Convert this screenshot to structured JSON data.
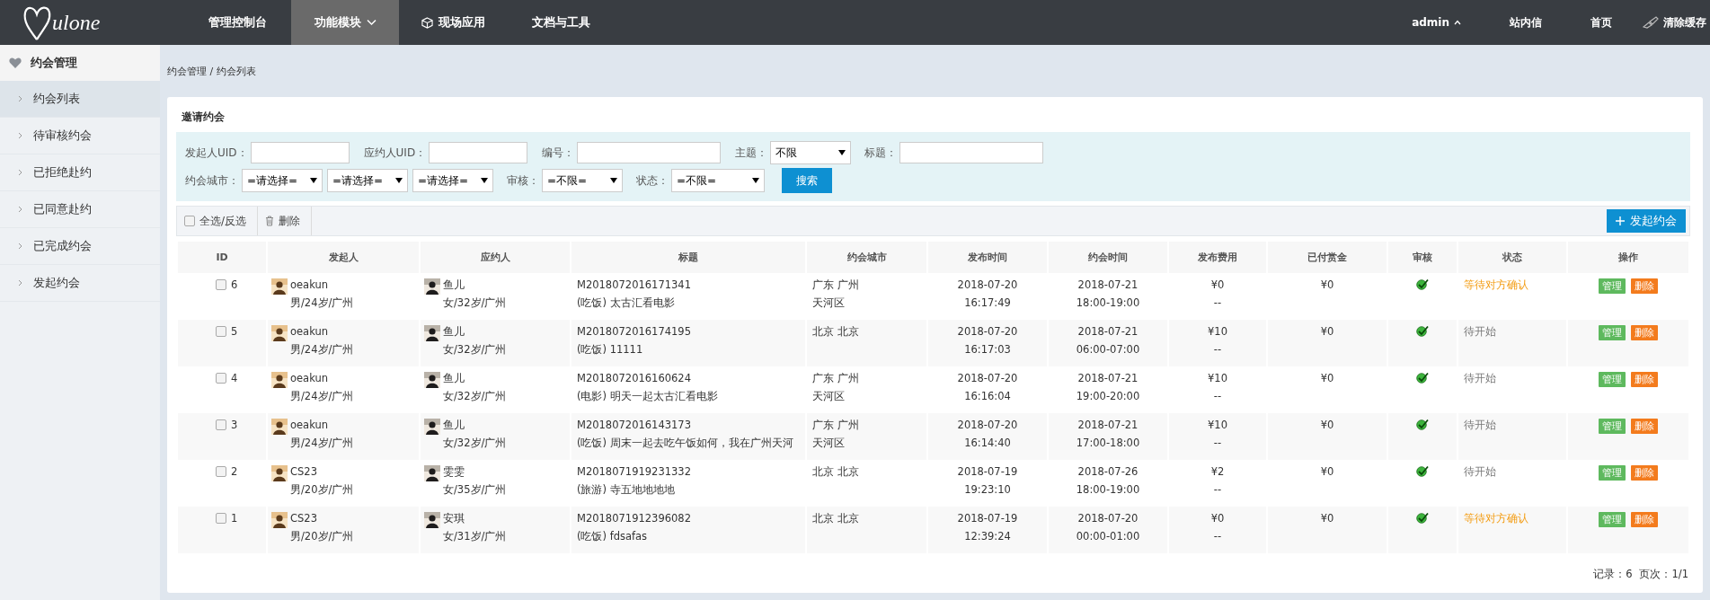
{
  "logo": "ulone",
  "nav": [
    {
      "label": "管理控制台",
      "selected": false,
      "dropdown": false,
      "kind": "text"
    },
    {
      "label": "功能模块",
      "selected": true,
      "dropdown": true,
      "kind": "text"
    },
    {
      "label": "现场应用",
      "selected": false,
      "dropdown": false,
      "kind": "cube"
    },
    {
      "label": "文档与工具",
      "selected": false,
      "dropdown": false,
      "kind": "text"
    }
  ],
  "user_nav": [
    {
      "label": "admin",
      "kind": "user"
    },
    {
      "label": "站内信",
      "kind": "link"
    },
    {
      "label": "首页",
      "kind": "link"
    },
    {
      "label": "清除缓存",
      "kind": "broom"
    }
  ],
  "sidebar": {
    "title": "约会管理",
    "items": [
      {
        "label": "约会列表",
        "selected": true
      },
      {
        "label": "待审核约会",
        "selected": false
      },
      {
        "label": "已拒绝赴约",
        "selected": false
      },
      {
        "label": "已同意赴约",
        "selected": false
      },
      {
        "label": "已完成约会",
        "selected": false
      },
      {
        "label": "发起约会",
        "selected": false
      }
    ]
  },
  "breadcrumb": "约会管理 / 约会列表",
  "panel_title": "邀请约会",
  "filter_rows": [
    [
      {
        "label": "发起人UID：",
        "kind": "input"
      },
      {
        "label": "应约人UID：",
        "kind": "input"
      },
      {
        "label": "编号：",
        "kind": "input-wide"
      },
      {
        "label": "主题：",
        "kind": "select",
        "value": "不限"
      },
      {
        "label": "标题：",
        "kind": "input-wide"
      }
    ],
    [
      {
        "label": "约会城市：",
        "kind": "select",
        "value": "=请选择="
      },
      {
        "kind": "select",
        "value": "=请选择="
      },
      {
        "kind": "select",
        "value": "=请选择="
      },
      {
        "label": "审核：",
        "kind": "select",
        "value": "=不限="
      },
      {
        "label": "状态：",
        "kind": "select-wide",
        "value": "=不限="
      }
    ]
  ],
  "search_button": "搜索",
  "toolbar": {
    "select_all": {
      "label": "全选/反选",
      "checked": false
    },
    "delete": "删除",
    "create": "发起约会"
  },
  "table": {
    "columns": [
      "ID",
      "发起人",
      "应约人",
      "标题",
      "约会城市",
      "发布时间",
      "约会时间",
      "发布费用",
      "已付赏金",
      "审核",
      "状态",
      "操作"
    ],
    "rows": [
      {
        "id": "6",
        "checked": false,
        "initiator": {
          "name": "oeakun",
          "info": "男/24岁/广州"
        },
        "invitee": {
          "name": "鱼儿",
          "info": "女/32岁/广州"
        },
        "title": {
          "code": "M2018072016171341",
          "text": "(吃饭) 太古汇看电影"
        },
        "city": [
          "广东 广州",
          "天河区"
        ],
        "published": [
          "2018-07-20",
          "16:17:49"
        ],
        "date": [
          "2018-07-21",
          "18:00-19:00"
        ],
        "fee": [
          "¥0",
          "--"
        ],
        "reward": "¥0",
        "approved": true,
        "status": {
          "text": "等待对方确认",
          "kind": "waiting"
        },
        "actions": [
          "管理",
          "删除"
        ]
      },
      {
        "id": "5",
        "checked": false,
        "initiator": {
          "name": "oeakun",
          "info": "男/24岁/广州"
        },
        "invitee": {
          "name": "鱼儿",
          "info": "女/32岁/广州"
        },
        "title": {
          "code": "M2018072016174195",
          "text": "(吃饭) 11111"
        },
        "city": [
          "北京 北京"
        ],
        "published": [
          "2018-07-20",
          "16:17:03"
        ],
        "date": [
          "2018-07-21",
          "06:00-07:00"
        ],
        "fee": [
          "¥10",
          "--"
        ],
        "reward": "¥0",
        "approved": true,
        "status": {
          "text": "待开始",
          "kind": "pending"
        },
        "actions": [
          "管理",
          "删除"
        ]
      },
      {
        "id": "4",
        "checked": false,
        "initiator": {
          "name": "oeakun",
          "info": "男/24岁/广州"
        },
        "invitee": {
          "name": "鱼儿",
          "info": "女/32岁/广州"
        },
        "title": {
          "code": "M2018072016160624",
          "text": "(电影) 明天一起太古汇看电影"
        },
        "city": [
          "广东 广州",
          "天河区"
        ],
        "published": [
          "2018-07-20",
          "16:16:04"
        ],
        "date": [
          "2018-07-21",
          "19:00-20:00"
        ],
        "fee": [
          "¥10",
          "--"
        ],
        "reward": "¥0",
        "approved": true,
        "status": {
          "text": "待开始",
          "kind": "pending"
        },
        "actions": [
          "管理",
          "删除"
        ]
      },
      {
        "id": "3",
        "checked": false,
        "initiator": {
          "name": "oeakun",
          "info": "男/24岁/广州"
        },
        "invitee": {
          "name": "鱼儿",
          "info": "女/32岁/广州"
        },
        "title": {
          "code": "M2018072016143173",
          "text": "(吃饭) 周末一起去吃午饭如何，我在广州天河"
        },
        "city": [
          "广东 广州",
          "天河区"
        ],
        "published": [
          "2018-07-20",
          "16:14:40"
        ],
        "date": [
          "2018-07-21",
          "17:00-18:00"
        ],
        "fee": [
          "¥10",
          "--"
        ],
        "reward": "¥0",
        "approved": true,
        "status": {
          "text": "待开始",
          "kind": "pending"
        },
        "actions": [
          "管理",
          "删除"
        ]
      },
      {
        "id": "2",
        "checked": false,
        "initiator": {
          "name": "CS23",
          "info": "男/20岁/广州"
        },
        "invitee": {
          "name": "雯雯",
          "info": "女/35岁/广州"
        },
        "title": {
          "code": "M2018071919231332",
          "text": "(旅游) 寺五地地地地"
        },
        "city": [
          "北京 北京"
        ],
        "published": [
          "2018-07-19",
          "19:23:10"
        ],
        "date": [
          "2018-07-26",
          "18:00-19:00"
        ],
        "fee": [
          "¥2",
          "--"
        ],
        "reward": "¥0",
        "approved": true,
        "status": {
          "text": "待开始",
          "kind": "pending"
        },
        "actions": [
          "管理",
          "删除"
        ]
      },
      {
        "id": "1",
        "checked": false,
        "initiator": {
          "name": "CS23",
          "info": "男/20岁/广州"
        },
        "invitee": {
          "name": "安琪",
          "info": "女/31岁/广州"
        },
        "title": {
          "code": "M2018071912396082",
          "text": "(吃饭) fdsafas"
        },
        "city": [
          "北京 北京"
        ],
        "published": [
          "2018-07-19",
          "12:39:24"
        ],
        "date": [
          "2018-07-20",
          "00:00-01:00"
        ],
        "fee": [
          "¥0",
          "--"
        ],
        "reward": "¥0",
        "approved": true,
        "status": {
          "text": "等待对方确认",
          "kind": "waiting"
        },
        "actions": [
          "管理",
          "删除"
        ]
      }
    ]
  },
  "footer": [
    "记录：6",
    "页次：1/1"
  ]
}
